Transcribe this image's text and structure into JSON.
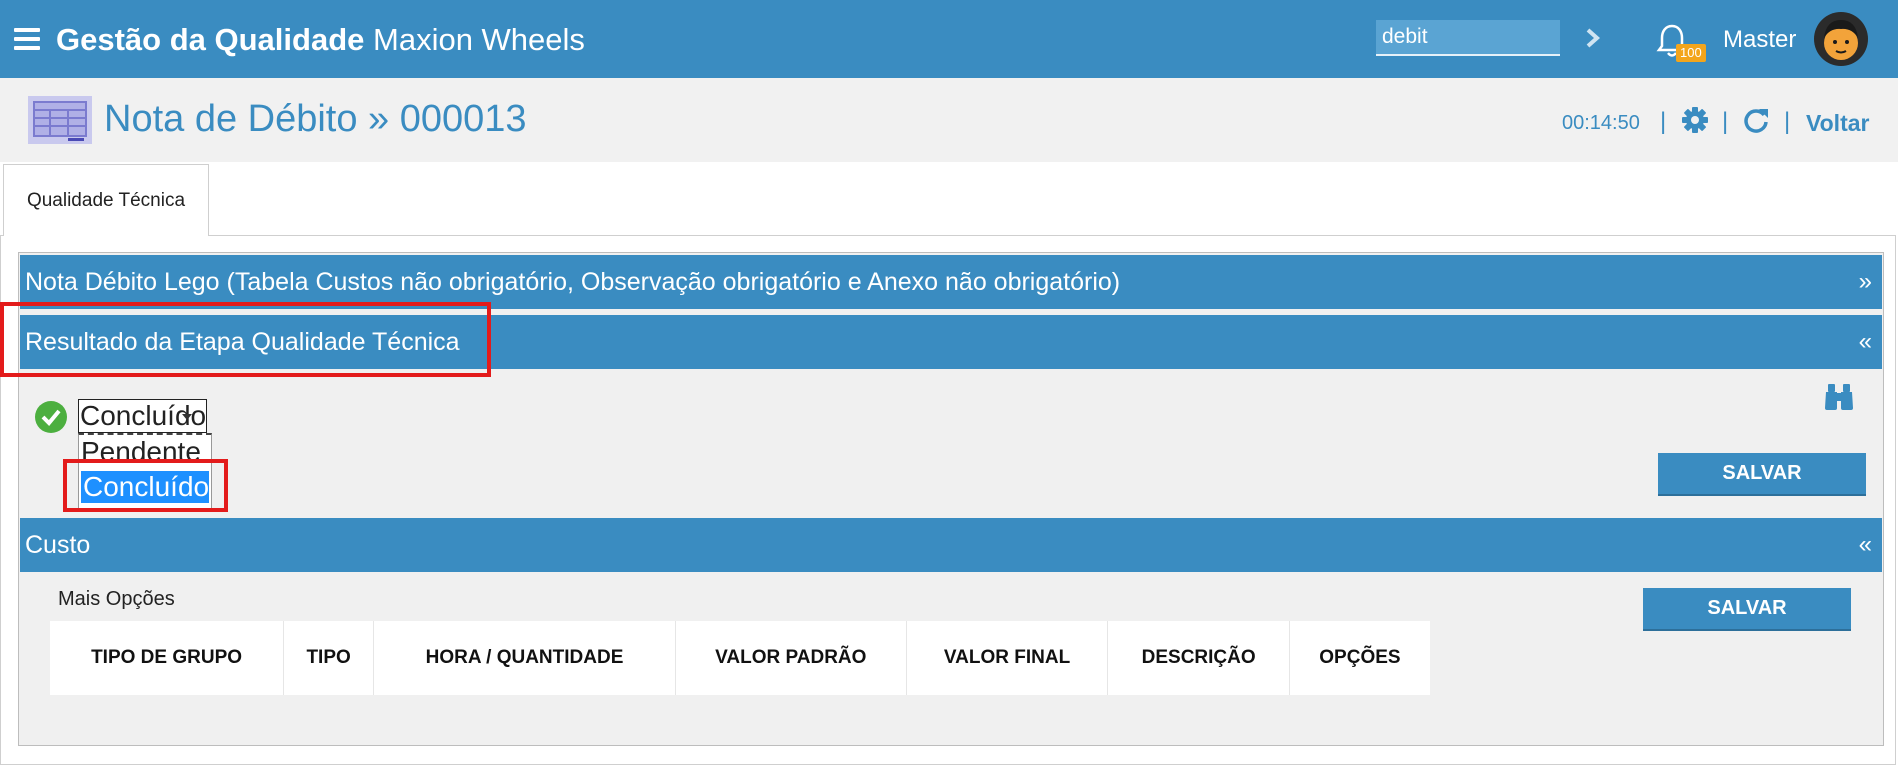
{
  "topbar": {
    "title_bold": "Gestão da Qualidade",
    "title_rest": "Maxion Wheels",
    "search_value": "debit",
    "notification_count": "100",
    "user_name": "Master"
  },
  "header": {
    "page_title": "Nota de Débito » 000013",
    "timer": "00:14:50",
    "separator": "|",
    "back_label": "Voltar"
  },
  "tabs": [
    {
      "label": "Qualidade Técnica",
      "active": true
    }
  ],
  "sections": {
    "nota": {
      "title": "Nota Débito Lego (Tabela Custos não obrigatório, Observação obrigatório e Anexo não obrigatório)",
      "chevron": "»"
    },
    "resultado": {
      "title": "Resultado da Etapa Qualidade Técnica",
      "chevron": "«"
    },
    "custo": {
      "title": "Custo",
      "chevron": "«"
    }
  },
  "resultado": {
    "selected_value": "Concluído",
    "options": [
      "Pendente",
      "Concluído"
    ],
    "save_label": "SALVAR"
  },
  "custo": {
    "more_options_label": "Mais Opções",
    "save_label": "SALVAR",
    "columns": [
      "TIPO DE GRUPO",
      "TIPO",
      "HORA / QUANTIDADE",
      "VALOR PADRÃO",
      "VALOR FINAL",
      "DESCRIÇÃO",
      "OPÇÕES"
    ]
  },
  "colors": {
    "primary": "#3a8cc1",
    "highlight": "#e31b1b",
    "success": "#4caf3f",
    "badge": "#f3a51c",
    "selection": "#1e90ff"
  },
  "icons": [
    "menu-icon",
    "chevron-right-icon",
    "bell-icon",
    "avatar",
    "table-icon",
    "gear-icon",
    "refresh-icon",
    "check-circle-icon",
    "binoculars-icon"
  ]
}
